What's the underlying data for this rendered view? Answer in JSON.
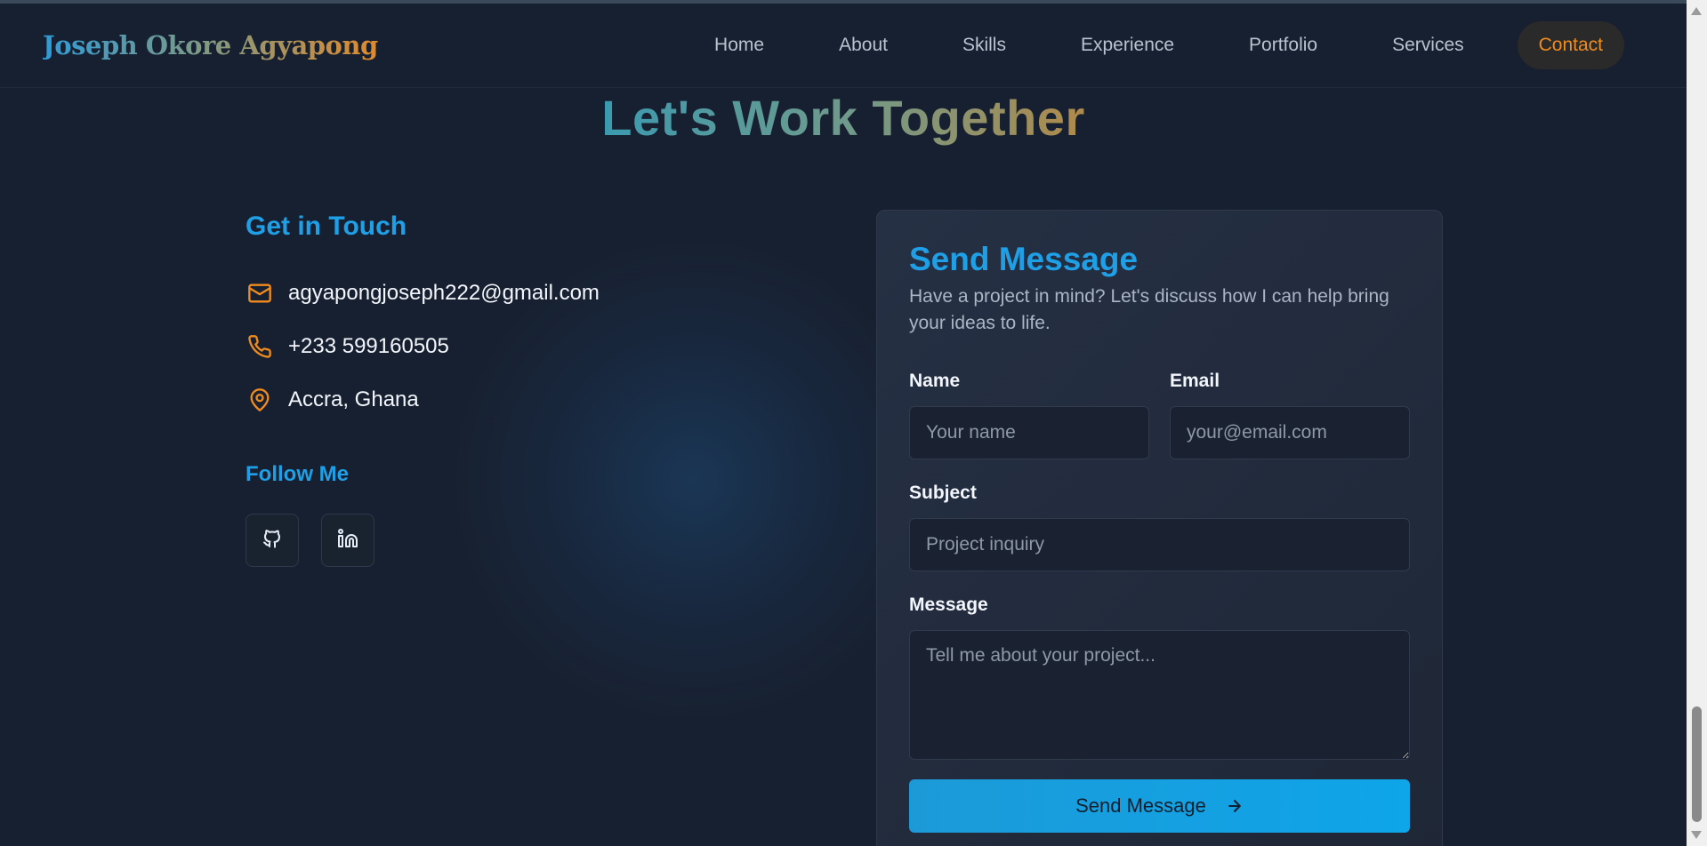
{
  "header": {
    "logo": "Joseph Okore Agyapong",
    "nav": [
      "Home",
      "About",
      "Skills",
      "Experience",
      "Portfolio",
      "Services",
      "Contact"
    ],
    "active_nav": "Contact"
  },
  "section": {
    "title": "Let's Work Together"
  },
  "contact": {
    "heading": "Get in Touch",
    "email": "agyapongjoseph222@gmail.com",
    "phone": "+233 599160505",
    "location": "Accra, Ghana",
    "follow_heading": "Follow Me",
    "socials": [
      "github-icon",
      "linkedin-icon"
    ]
  },
  "form": {
    "title": "Send Message",
    "subtitle": "Have a project in mind? Let's discuss how I can help bring your ideas to life.",
    "name_label": "Name",
    "name_placeholder": "Your name",
    "email_label": "Email",
    "email_placeholder": "your@email.com",
    "subject_label": "Subject",
    "subject_placeholder": "Project inquiry",
    "message_label": "Message",
    "message_placeholder": "Tell me about your project...",
    "submit_label": "Send Message"
  },
  "colors": {
    "background": "#172030",
    "accent_blue": "#1fa0e6",
    "accent_orange": "#f08b1e",
    "card": "#253044"
  }
}
